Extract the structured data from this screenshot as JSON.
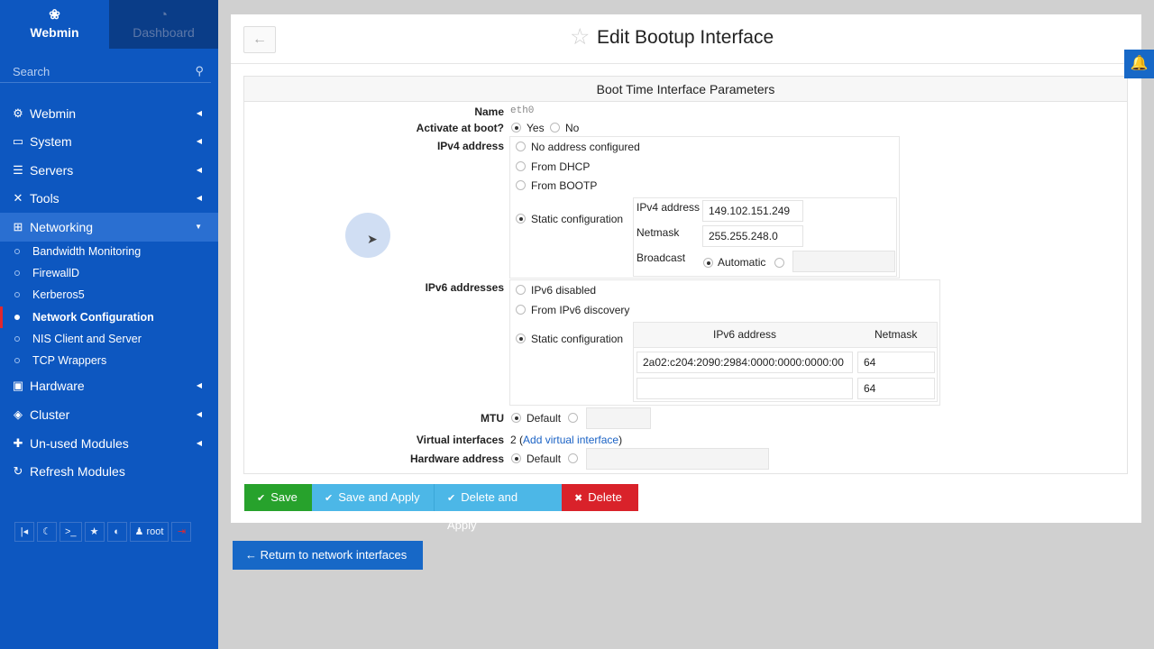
{
  "sidebar": {
    "tab_webmin": "Webmin",
    "tab_dashboard": "Dashboard",
    "search_placeholder": "Search",
    "items": [
      {
        "label": "Webmin",
        "icon": "gear-icon"
      },
      {
        "label": "System",
        "icon": "laptop-icon"
      },
      {
        "label": "Servers",
        "icon": "servers-icon"
      },
      {
        "label": "Tools",
        "icon": "tools-icon"
      },
      {
        "label": "Networking",
        "icon": "sitemap-icon"
      },
      {
        "label": "Hardware",
        "icon": "hdd-icon"
      },
      {
        "label": "Cluster",
        "icon": "layers-icon"
      },
      {
        "label": "Un-used Modules",
        "icon": "puzzle-icon"
      },
      {
        "label": "Refresh Modules",
        "icon": "refresh-icon"
      }
    ],
    "sub_items": [
      "Bandwidth Monitoring",
      "FirewallD",
      "Kerberos5",
      "Network Configuration",
      "NIS Client and Server",
      "TCP Wrappers"
    ],
    "bottom": {
      "user": "root"
    }
  },
  "header": {
    "title": "Edit Bootup Interface"
  },
  "form": {
    "section_title": "Boot Time Interface Parameters",
    "name_label": "Name",
    "name_value": "eth0",
    "activate_label": "Activate at boot?",
    "yes": "Yes",
    "no": "No",
    "ipv4_label": "IPv4 address",
    "ipv4_opts": [
      "No address configured",
      "From DHCP",
      "From BOOTP",
      "Static configuration"
    ],
    "ipv4_addr_label": "IPv4 address",
    "ipv4_addr_value": "149.102.151.249",
    "netmask_label": "Netmask",
    "netmask_value": "255.255.248.0",
    "broadcast_label": "Broadcast",
    "automatic": "Automatic",
    "ipv6_label": "IPv6 addresses",
    "ipv6_opts": [
      "IPv6 disabled",
      "From IPv6 discovery",
      "Static configuration"
    ],
    "ipv6_col_addr": "IPv6 address",
    "ipv6_col_mask": "Netmask",
    "ipv6_rows": [
      {
        "addr": "2a02:c204:2090:2984:0000:0000:0000:00",
        "mask": "64"
      },
      {
        "addr": "",
        "mask": "64"
      }
    ],
    "mtu_label": "MTU",
    "default": "Default",
    "virtual_label": "Virtual interfaces",
    "virtual_count": "2 (",
    "virtual_link": "Add virtual interface",
    "virtual_close": ")",
    "hw_label": "Hardware address"
  },
  "actions": {
    "save": "Save",
    "save_apply": "Save and Apply",
    "delete_apply": "Delete and Apply",
    "delete": "Delete"
  },
  "return_label": "Return to network interfaces",
  "colors": {
    "sidebar": "#0d57c0",
    "save": "#27a22c",
    "apply": "#4cb7e7",
    "delete": "#d9222a"
  }
}
